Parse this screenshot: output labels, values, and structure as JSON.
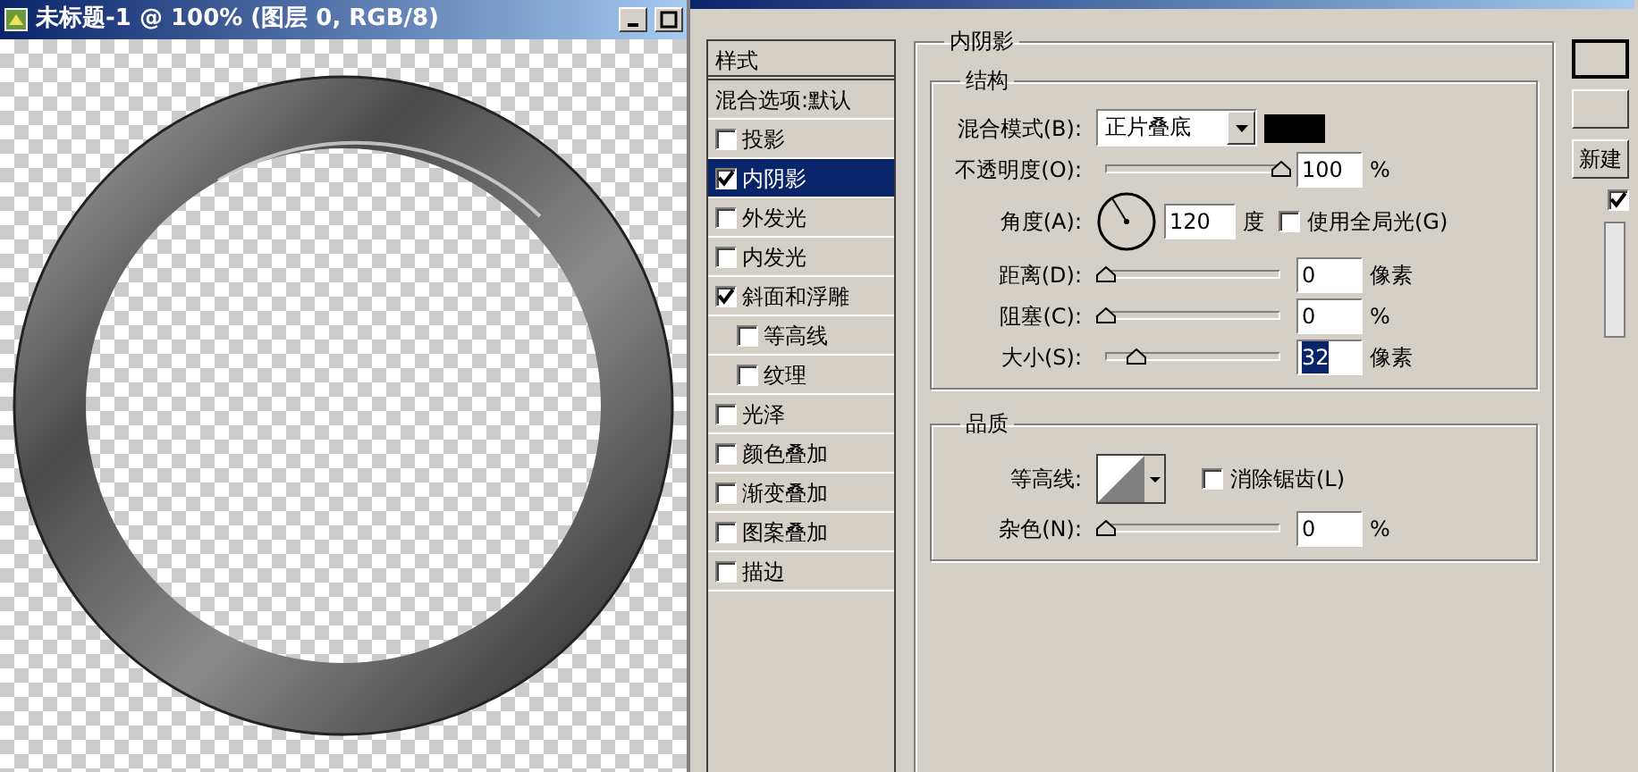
{
  "document_window": {
    "title": "未标题-1 @ 100% (图层 0, RGB/8)"
  },
  "styles_panel": {
    "header": "样式",
    "items": [
      {
        "label": "混合选项:默认",
        "kind": "plain",
        "selected": false
      },
      {
        "label": "投影",
        "kind": "check",
        "checked": false,
        "selected": false
      },
      {
        "label": "内阴影",
        "kind": "check",
        "checked": true,
        "selected": true
      },
      {
        "label": "外发光",
        "kind": "check",
        "checked": false,
        "selected": false
      },
      {
        "label": "内发光",
        "kind": "check",
        "checked": false,
        "selected": false
      },
      {
        "label": "斜面和浮雕",
        "kind": "check",
        "checked": true,
        "selected": false,
        "children": [
          {
            "label": "等高线",
            "kind": "check",
            "checked": false,
            "selected": false
          },
          {
            "label": "纹理",
            "kind": "check",
            "checked": false,
            "selected": false
          }
        ]
      },
      {
        "label": "光泽",
        "kind": "check",
        "checked": false,
        "selected": false
      },
      {
        "label": "颜色叠加",
        "kind": "check",
        "checked": false,
        "selected": false
      },
      {
        "label": "渐变叠加",
        "kind": "check",
        "checked": false,
        "selected": false
      },
      {
        "label": "图案叠加",
        "kind": "check",
        "checked": false,
        "selected": false
      },
      {
        "label": "描边",
        "kind": "check",
        "checked": false,
        "selected": false
      }
    ]
  },
  "settings": {
    "title": "内阴影",
    "structure": {
      "title": "结构",
      "blend_mode": {
        "label": "混合模式(B):",
        "value": "正片叠底",
        "color": "#000000"
      },
      "opacity": {
        "label": "不透明度(O):",
        "level": 1.0,
        "value": "100",
        "unit": "%"
      },
      "angle": {
        "label": "角度(A):",
        "value": "120",
        "unit": "度",
        "global_light": {
          "label": "使用全局光(G)",
          "checked": false
        }
      },
      "distance": {
        "label": "距离(D):",
        "level": 0,
        "value": "0",
        "unit": "像素"
      },
      "choke": {
        "label": "阻塞(C):",
        "level": 0,
        "value": "0",
        "unit": "%"
      },
      "size": {
        "label": "大小(S):",
        "level": 0.17,
        "value": "32",
        "unit": "像素",
        "selected": true
      }
    },
    "quality": {
      "title": "品质",
      "contour": {
        "label": "等高线:"
      },
      "anti_alias": {
        "label": "消除锯齿(L)",
        "checked": false
      },
      "noise": {
        "label": "杂色(N):",
        "level": 0,
        "value": "0",
        "unit": "%"
      }
    }
  },
  "side_buttons": {
    "new_label": "新建",
    "preview_checked": true
  }
}
